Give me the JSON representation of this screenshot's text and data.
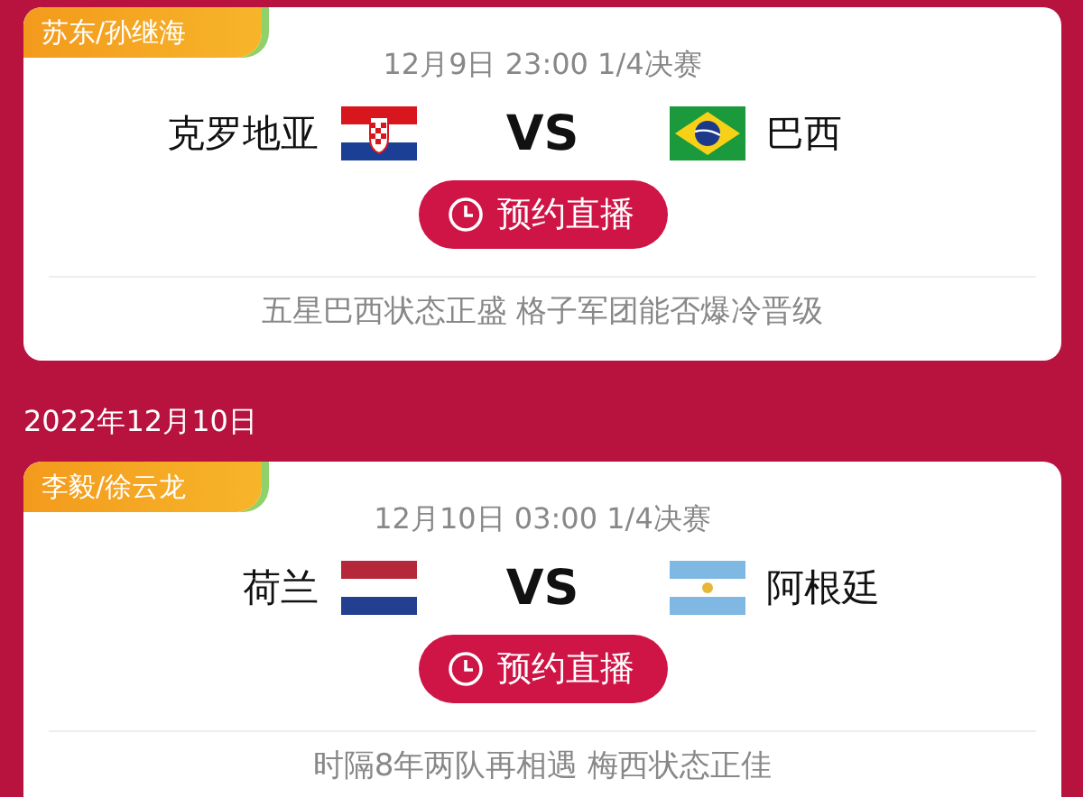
{
  "feed": [
    {
      "kind": "match",
      "commentators": "苏东/孙继海",
      "schedule": "12月9日 23:00 1/4决赛",
      "home": {
        "name": "克罗地亚",
        "kind": "croatia"
      },
      "vs": "VS",
      "away": {
        "name": "巴西",
        "kind": "brazil"
      },
      "button": "预约直播",
      "headline": "五星巴西状态正盛 格子军团能否爆冷晋级"
    },
    {
      "kind": "date",
      "text": "2022年12月10日"
    },
    {
      "kind": "match",
      "commentators": "李毅/徐云龙",
      "schedule": "12月10日 03:00 1/4决赛",
      "home": {
        "name": "荷兰",
        "kind": "netherlands"
      },
      "vs": "VS",
      "away": {
        "name": "阿根廷",
        "kind": "argentina"
      },
      "button": "预约直播",
      "headline": "时隔8年两队再相遇 梅西状态正佳"
    }
  ]
}
